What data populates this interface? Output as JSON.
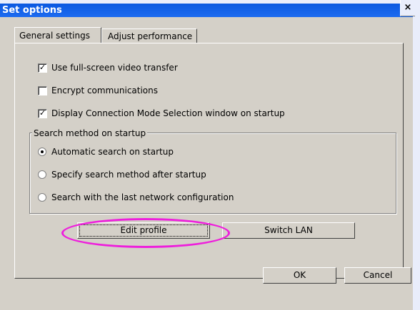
{
  "window": {
    "title": "Set options",
    "close_glyph": "×"
  },
  "tabs": [
    {
      "label": "General settings"
    },
    {
      "label": "Adjust performance"
    }
  ],
  "general": {
    "checkboxes": [
      {
        "label": "Use full-screen video transfer",
        "checked": true
      },
      {
        "label": "Encrypt communications",
        "checked": false
      },
      {
        "label": "Display Connection Mode Selection window on startup",
        "checked": true
      }
    ],
    "search_group": {
      "legend": "Search method on startup",
      "options": [
        {
          "label": "Automatic search on startup",
          "selected": true
        },
        {
          "label": "Specify search method after startup",
          "selected": false
        },
        {
          "label": "Search with the last network configuration",
          "selected": false
        }
      ]
    },
    "edit_profile_label": "Edit profile",
    "switch_lan_label": "Switch LAN"
  },
  "footer": {
    "ok_label": "OK",
    "cancel_label": "Cancel"
  },
  "annotation": {
    "highlight_color": "#ee1fdc"
  }
}
